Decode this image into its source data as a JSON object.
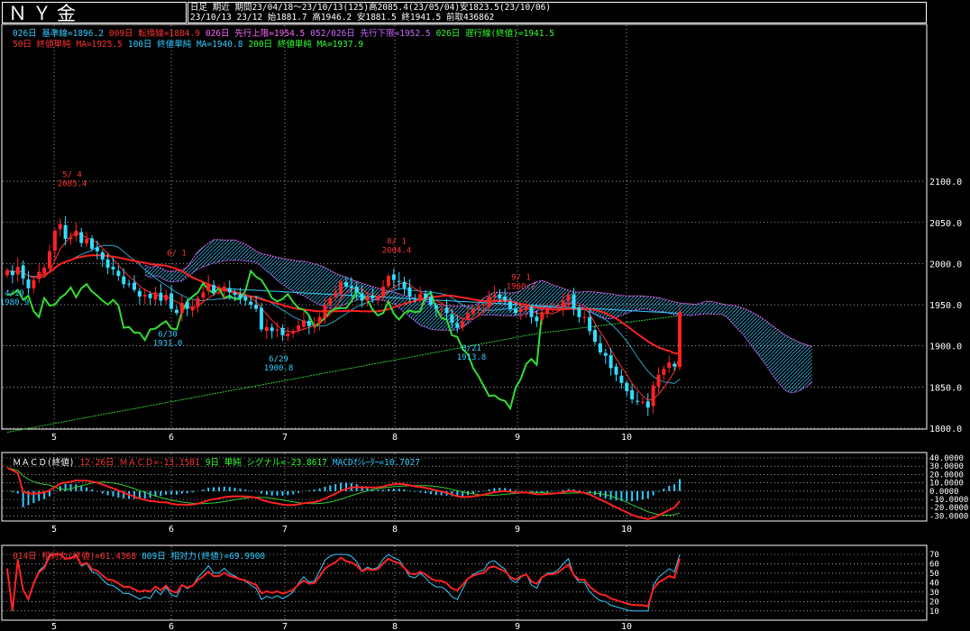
{
  "header": {
    "title": "ＮＹ金",
    "info_line1": "日足 期近 期間23/04/18～23/10/13(125)高2085.4(23/05/04)安1823.5(23/10/06)",
    "info_line2": "23/10/13 23/12 始1881.7 高1946.2 安1881.5 終1941.5 前取436862"
  },
  "main_legend": {
    "line1": [
      {
        "text": "026日 基準線=1896.2",
        "color": "#33ccff"
      },
      {
        "text": "009日 転換線=1884.9",
        "color": "#ff3333"
      },
      {
        "text": "026日 先行上限=1954.5",
        "color": "#ff66ff"
      },
      {
        "text": "052/026日 先行下限=1952.5",
        "color": "#cc66ff"
      },
      {
        "text": "026日 遅行線(終値)=1941.5",
        "color": "#33ff33"
      }
    ],
    "line2": [
      {
        "text": "50日 終値単純 MA=1925.5",
        "color": "#ff3333"
      },
      {
        "text": "100日 終値単純 MA=1940.8",
        "color": "#33ccff"
      },
      {
        "text": "200日 終値単純 MA=1937.9",
        "color": "#33ff33"
      }
    ]
  },
  "macd_legend": [
    {
      "text": "ＭＡＣＤ(終値)",
      "color": "#ffffff"
    },
    {
      "text": "12-26日 ＭＡＣＤ=-13.1581",
      "color": "#ff3333"
    },
    {
      "text": "9日 単純 シグナル=-23.8617",
      "color": "#33ff33"
    },
    {
      "text": "MACDｵｼﾚｰﾀｰ=10.7027",
      "color": "#33ccff"
    }
  ],
  "rsi_legend": [
    {
      "text": "014日 相対力(終値)=61.4368",
      "color": "#ff3333"
    },
    {
      "text": "009日 相対力(終値)=69.9900",
      "color": "#33ccff"
    }
  ],
  "annotations": [
    {
      "date": "5/4",
      "price": 2085.4,
      "label": "5/ 4",
      "value": "2085.4",
      "color": "#ff3333"
    },
    {
      "date": "6/1",
      "price": 1990.0,
      "label": "6/ 1",
      "value": "",
      "color": "#ff3333"
    },
    {
      "date": "6/29",
      "price": 1900.8,
      "label": "6/29",
      "value": "1900.8",
      "color": "#33ccff"
    },
    {
      "date": "6/30",
      "price": 1931.0,
      "label": "6/30",
      "value": "1931.0",
      "color": "#33ccff"
    },
    {
      "date": "8/1",
      "price": 2004.4,
      "label": "8/ 1",
      "value": "2004.4",
      "color": "#ff3333"
    },
    {
      "date": "8/21",
      "price": 1913.8,
      "label": "8/21",
      "value": "1913.8",
      "color": "#33ccff"
    },
    {
      "date": "9/1",
      "price": 1960.2,
      "label": "9/ 1",
      "value": "1960.2",
      "color": "#ff3333"
    },
    {
      "date": "4/19",
      "price": 1980.9,
      "label": "4/19",
      "value": "1980.9",
      "color": "#33ccff"
    }
  ],
  "chart_data": [
    {
      "type": "candlestick",
      "title": "ＮＹ金",
      "x_ticks": [
        "5",
        "6",
        "7",
        "8",
        "9",
        "10"
      ],
      "ylim": [
        1800,
        2100
      ],
      "y_ticks": [
        "1800.0",
        "1850.0",
        "1900.0",
        "1950.0",
        "2000.0",
        "2050.0",
        "2100.0"
      ],
      "closes": [
        1992,
        1986,
        1996,
        1982,
        1970,
        1980,
        1990,
        1995,
        2015,
        2040,
        2048,
        2030,
        2032,
        2040,
        2025,
        2030,
        2018,
        2015,
        2005,
        1995,
        1993,
        1985,
        1975,
        1975,
        1968,
        1960,
        1962,
        1958,
        1965,
        1955,
        1962,
        1945,
        1940,
        1952,
        1945,
        1948,
        1958,
        1965,
        1975,
        1965,
        1965,
        1972,
        1965,
        1962,
        1958,
        1955,
        1950,
        1945,
        1920,
        1923,
        1918,
        1920,
        1913,
        1915,
        1918,
        1925,
        1931,
        1924,
        1925,
        1935,
        1950,
        1958,
        1965,
        1978,
        1972,
        1970,
        1965,
        1955,
        1960,
        1958,
        1960,
        1972,
        1985,
        1980,
        1978,
        1970,
        1960,
        1958,
        1963,
        1958,
        1950,
        1945,
        1945,
        1940,
        1928,
        1922,
        1930,
        1940,
        1945,
        1948,
        1950,
        1960,
        1962,
        1958,
        1955,
        1945,
        1940,
        1945,
        1948,
        1935,
        1930,
        1940,
        1945,
        1945,
        1948,
        1955,
        1962,
        1945,
        1935,
        1935,
        1918,
        1905,
        1892,
        1888,
        1873,
        1865,
        1855,
        1845,
        1835,
        1832,
        1832,
        1825,
        1852,
        1865,
        1872,
        1880,
        1875,
        1941.5
      ],
      "ma50_last": 1925.5,
      "ma100_last": 1940.8,
      "ma200_last": 1937.9
    },
    {
      "type": "line",
      "title": "ＭＡＣＤ(終値)",
      "y_ticks": [
        "40.0000",
        "30.0000",
        "20.0000",
        "10.0000",
        "0.0000",
        "-10.0000",
        "-20.0000",
        "-30.0000"
      ],
      "ylim": [
        -35,
        40
      ],
      "macd_last": -13.1581,
      "signal_last": -23.8617,
      "oscillator_last": 10.7027
    },
    {
      "type": "line",
      "title": "相対力",
      "y_ticks": [
        "70",
        "60",
        "50",
        "40",
        "30",
        "20",
        "10"
      ],
      "ylim": [
        5,
        72
      ],
      "rsi14_last": 61.4368,
      "rsi9_last": 69.99
    }
  ]
}
